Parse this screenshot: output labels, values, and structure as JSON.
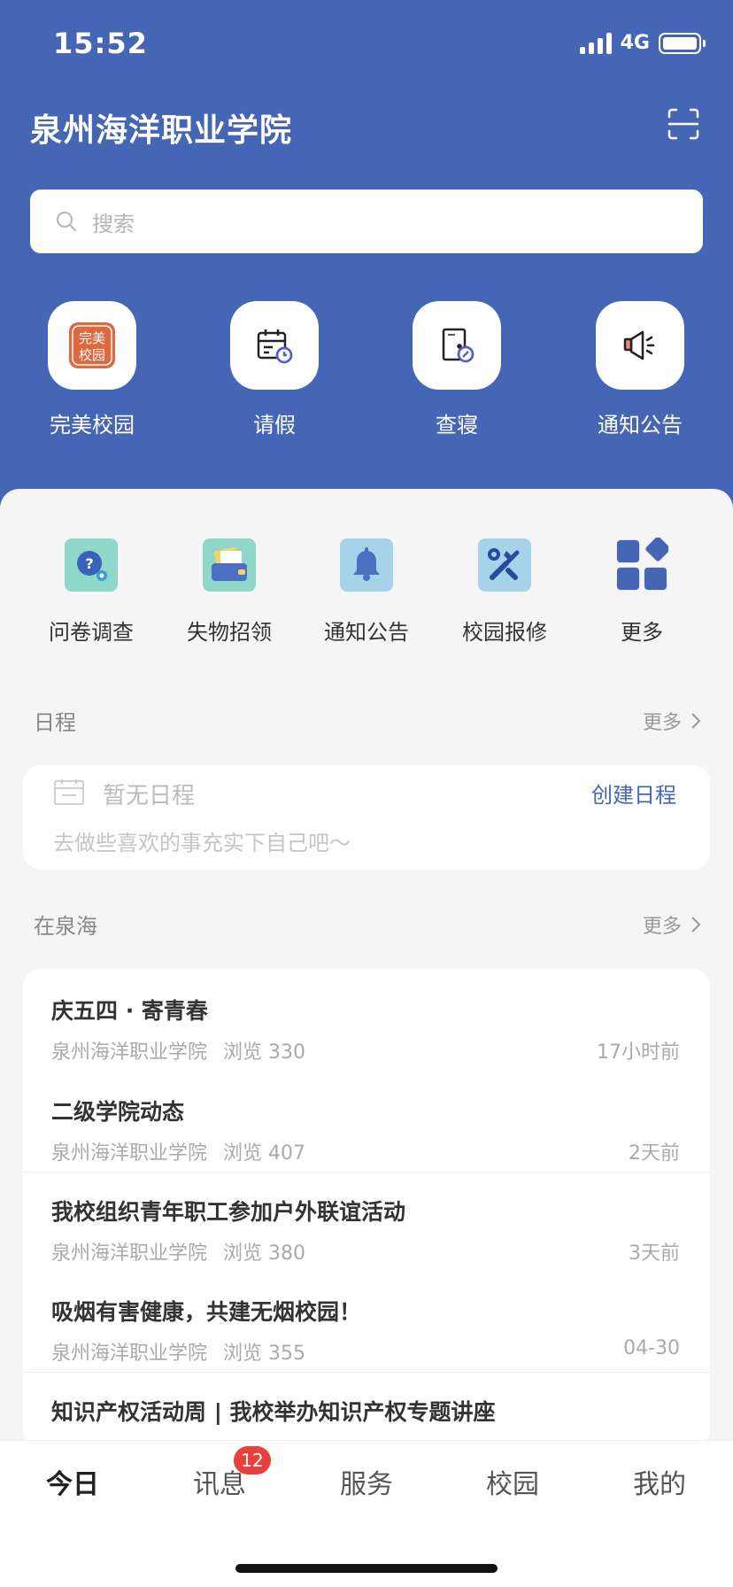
{
  "status_bar": {
    "time": "15:52",
    "network": "4G"
  },
  "header": {
    "title": "泉州海洋职业学院"
  },
  "search": {
    "placeholder": "搜索"
  },
  "quick_actions": [
    {
      "label": "完美校园",
      "icon": "perfect-campus-logo",
      "logo_text": "完美\n校园"
    },
    {
      "label": "请假",
      "icon": "calendar-clock-icon"
    },
    {
      "label": "查寝",
      "icon": "dorm-check-icon"
    },
    {
      "label": "通知公告",
      "icon": "megaphone-icon"
    }
  ],
  "services": [
    {
      "label": "问卷调查",
      "icon": "questionnaire-icon"
    },
    {
      "label": "失物招领",
      "icon": "wallet-icon"
    },
    {
      "label": "通知公告",
      "icon": "bell-icon"
    },
    {
      "label": "校园报修",
      "icon": "repair-tools-icon"
    },
    {
      "label": "更多",
      "icon": "grid-more-icon"
    }
  ],
  "schedule": {
    "title": "日程",
    "more": "更多",
    "empty": "暂无日程",
    "create": "创建日程",
    "tip": "去做些喜欢的事充实下自己吧～"
  },
  "news": {
    "title": "在泉海",
    "more": "更多",
    "items": [
      {
        "title": "庆五四 · 寄青春",
        "source": "泉州海洋职业学院",
        "views": "浏览 330",
        "time": "17小时前"
      },
      {
        "title": "二级学院动态",
        "source": "泉州海洋职业学院",
        "views": "浏览 407",
        "time": "2天前"
      },
      {
        "title": "我校组织青年职工参加户外联谊活动",
        "source": "泉州海洋职业学院",
        "views": "浏览 380",
        "time": "3天前"
      },
      {
        "title": "吸烟有害健康，共建无烟校园！",
        "source": "泉州海洋职业学院",
        "views": "浏览 355",
        "time": "04-30"
      },
      {
        "title": "知识产权活动周 | 我校举办知识产权专题讲座",
        "source": "",
        "views": "",
        "time": ""
      }
    ]
  },
  "tabbar": {
    "tabs": [
      {
        "label": "今日",
        "active": true
      },
      {
        "label": "讯息",
        "badge": "12"
      },
      {
        "label": "服务"
      },
      {
        "label": "校园"
      },
      {
        "label": "我的"
      }
    ]
  },
  "colors": {
    "brand": "#4566b5",
    "badge": "#e8413b",
    "background": "#f5f5f5"
  }
}
